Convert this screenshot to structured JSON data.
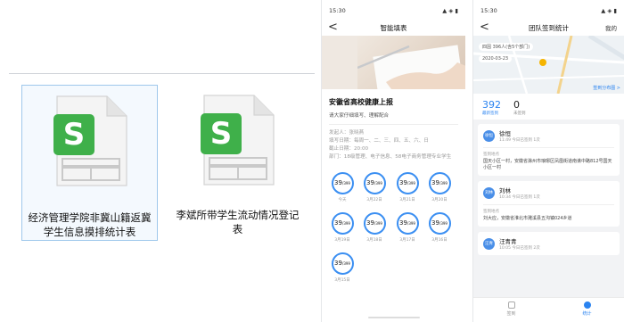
{
  "files": [
    {
      "name": "经济管理学院非冀山籍返冀学生信息摸排统计表",
      "icon": "spreadsheet-icon",
      "selected": true
    },
    {
      "name": "李斌所带学生流动情况登记表",
      "icon": "spreadsheet-icon",
      "selected": false
    }
  ],
  "phone1": {
    "status": {
      "time": "15:30",
      "icons": "▲ ◈ ▮"
    },
    "nav": {
      "back": "<",
      "title": "智能填表"
    },
    "form_title": "安徽省高校健康上报",
    "form_sub": "请大家仔细填写、理解配合",
    "meta": [
      "发起人：张晓燕",
      "填写日期：每周一、二、三、四、五、六、日",
      "截止日期：20:00",
      "部门：18级管理、电子信息、58电子商务管理专业学生"
    ],
    "rings": [
      {
        "value": "39",
        "total": "/399",
        "label": "今天"
      },
      {
        "value": "39",
        "total": "/399",
        "label": "3月22日"
      },
      {
        "value": "39",
        "total": "/399",
        "label": "3月21日"
      },
      {
        "value": "39",
        "total": "/399",
        "label": "3月20日"
      },
      {
        "value": "39",
        "total": "/399",
        "label": "3月19日"
      },
      {
        "value": "39",
        "total": "/399",
        "label": "3月18日"
      },
      {
        "value": "39",
        "total": "/399",
        "label": "3月17日"
      },
      {
        "value": "39",
        "total": "/399",
        "label": "3月16日"
      },
      {
        "value": "39",
        "total": "/399",
        "label": "3月15日"
      }
    ]
  },
  "phone2": {
    "status": {
      "time": "15:30",
      "icons": "▲ ◈ ▮"
    },
    "nav": {
      "back": "<",
      "title": "团队签到统计",
      "right": "我的"
    },
    "map": {
      "range": "四因 396人(含5个部门)",
      "date": "2020-03-23",
      "link": "签到分布图 >"
    },
    "kpi": {
      "signed_num": "392",
      "signed_label": "最新签到",
      "unsigned_num": "0",
      "unsigned_label": "未签到"
    },
    "people": [
      {
        "name": "徐恒",
        "avatar": "徐恒",
        "time": "11:49 今日已签到 1次",
        "addr_label": "签到地点",
        "addr": "国天小区一村，安徽省滁州市琅琊区凤凰街道南谯中路812号国天小区一村"
      },
      {
        "name": "刘林",
        "avatar": "刘林",
        "time": "10:34 今日已签到 1次",
        "addr_label": "签到地点",
        "addr": "刘大应，安徽省淮北市濉溪县五沟镇024乡道"
      },
      {
        "name": "汪青青",
        "avatar": "汪青",
        "time": "10:05 今日已签到 2次",
        "addr_label": "",
        "addr": ""
      }
    ],
    "tabs": [
      {
        "label": "签到",
        "active": false
      },
      {
        "label": "统计",
        "active": true
      }
    ]
  }
}
